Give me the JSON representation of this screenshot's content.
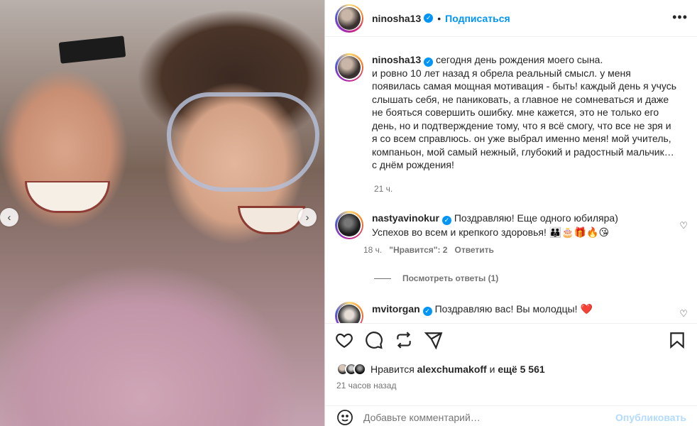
{
  "post": {
    "username": "ninosha13",
    "follow_label": "Подписаться",
    "more_label": "•••",
    "caption": "сегодня день рождения моего сына.\nи ровно 10 лет назад я обрела реальный смысл. у меня появилась самая мощная мотивация - быть! каждый день я учусь слышать себя, не паниковать, а главное не сомневаться и даже не бояться совершить ошибку. мне кажется, это не только его день, но и подтверждение тому, что я всё смогу, что все не зря и я со всем справлюсь. он уже выбрал именно меня! мой учитель, компаньон, мой самый нежный, глубокий и радостный мальчик… с днём рождения!",
    "caption_time": "21 ч.",
    "carousel": {
      "prev": "‹",
      "next": "›"
    }
  },
  "comments": [
    {
      "username": "nastyavinokur",
      "text": "Поздравляю! Еще одного юбиляра)\nУспехов во всем и крепкого здоровья! 🧑‍🧑‍🧒🎂🎁🔥😘",
      "time": "18 ч.",
      "likes": "\"Нравится\": 2",
      "reply": "Ответить",
      "view_replies": "Посмотреть ответы (1)"
    },
    {
      "username": "mvitorgan",
      "text": "Поздравляю вас! Вы молодцы! ❤️"
    }
  ],
  "likes": {
    "prefix": "Нравится",
    "user": "alexchumakoff",
    "and": "и",
    "count": "ещё 5 561"
  },
  "posted_ago": "21 часов назад",
  "add_comment": {
    "placeholder": "Добавьте комментарий…",
    "publish": "Опубликовать"
  },
  "colors": {
    "accent": "#0095f6",
    "muted": "#737373",
    "text": "#262626",
    "like_red": "#ed4956"
  }
}
